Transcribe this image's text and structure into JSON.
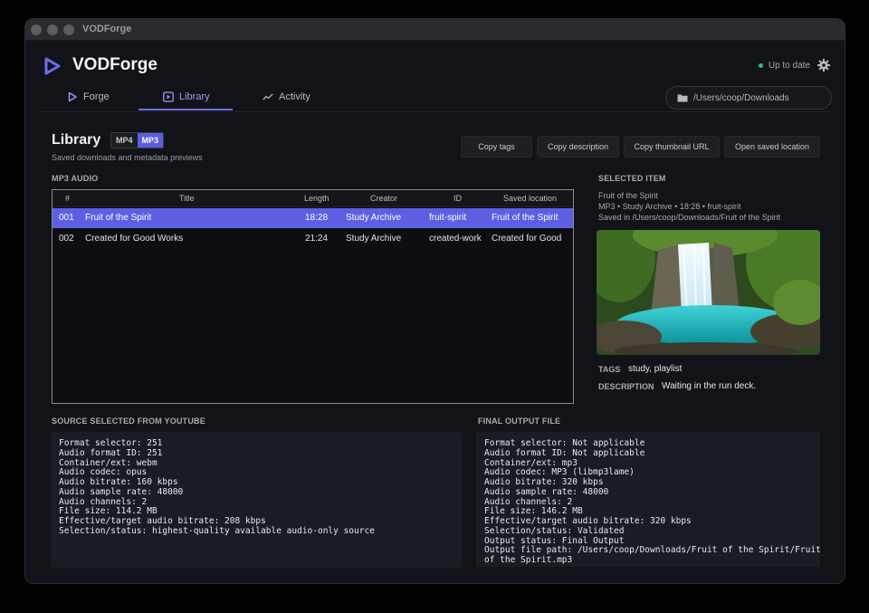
{
  "window": {
    "title": "VODForge"
  },
  "brand": {
    "name": "VODForge"
  },
  "status": {
    "text": "Up to date",
    "dot_color": "#33c47a"
  },
  "nav": {
    "tabs": [
      {
        "label": "Forge",
        "icon": "play-icon"
      },
      {
        "label": "Library",
        "icon": "library-icon",
        "active": true
      },
      {
        "label": "Activity",
        "icon": "activity-icon"
      }
    ],
    "path": "/Users/coop/Downloads"
  },
  "library": {
    "title": "Library",
    "formats": [
      "MP4",
      "MP3"
    ],
    "selected_format": "MP3",
    "subtitle": "Saved downloads and metadata previews",
    "actions": [
      "Copy tags",
      "Copy description",
      "Copy thumbnail URL",
      "Open saved location"
    ]
  },
  "table": {
    "label": "MP3 AUDIO",
    "headers": [
      "#",
      "Title",
      "Length",
      "Creator",
      "ID",
      "Saved location"
    ],
    "rows": [
      [
        "001",
        "Fruit of the Spirit",
        "18:28",
        "Study Archive",
        "fruit-spirit",
        "Fruit of the Spirit"
      ],
      [
        "002",
        "Created for Good Works",
        "21:24",
        "Study Archive",
        "created-work",
        "Created for Good"
      ]
    ],
    "selected_row": 0
  },
  "selected": {
    "label": "SELECTED ITEM",
    "title": "Fruit of the Spirit",
    "meta": "MP3 • Study Archive • 18:28 • fruit-spirit",
    "saved_in": "Saved in /Users/coop/Downloads/Fruit of the Spirit",
    "tags_label": "TAGS",
    "tags": "study, playlist",
    "description_label": "DESCRIPTION",
    "description": "Waiting in the run deck."
  },
  "source": {
    "label": "SOURCE SELECTED FROM YOUTUBE",
    "lines": [
      "Format selector: 251",
      "Audio format ID: 251",
      "Container/ext: webm",
      "Audio codec: opus",
      "Audio bitrate: 160 kbps",
      "Audio sample rate: 48000",
      "Audio channels: 2",
      "File size: 114.2 MB",
      "Effective/target audio bitrate: 208 kbps",
      "Selection/status: highest-quality available audio-only source"
    ]
  },
  "output": {
    "label": "FINAL OUTPUT FILE",
    "lines": [
      "Format selector: Not applicable",
      "Audio format ID: Not applicable",
      "Container/ext: mp3",
      "Audio codec: MP3 (libmp3lame)",
      "Audio bitrate: 320 kbps",
      "Audio sample rate: 48000",
      "Audio channels: 2",
      "File size: 146.2 MB",
      "Effective/target audio bitrate: 320 kbps",
      "Selection/status: Validated",
      "Output status: Final Output",
      "Output file path: /Users/coop/Downloads/Fruit of the Spirit/Fruit",
      "of the Spirit.mp3"
    ]
  },
  "colors": {
    "accent": "#5d5fe3",
    "background": "#121318"
  }
}
